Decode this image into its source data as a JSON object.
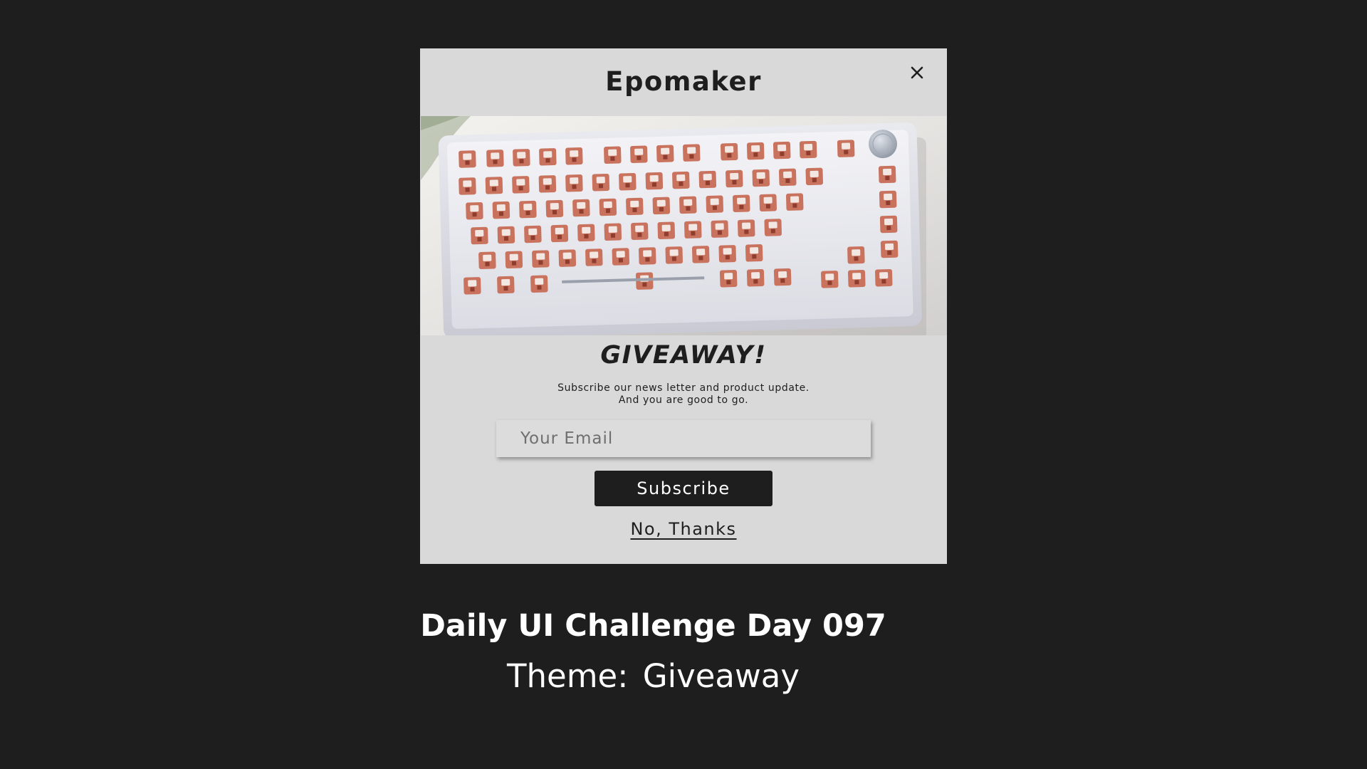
{
  "modal": {
    "brand": "Epomaker",
    "close_icon": "close-icon",
    "hero_image": "mechanical-keyboard-photo",
    "title": "GIVEAWAY!",
    "subtitle_line1": "Subscribe our news letter and product update.",
    "subtitle_line2": "And you are good to go.",
    "email_placeholder": "Your Email",
    "email_value": "",
    "subscribe_label": "Subscribe",
    "dismiss_label": "No, Thanks"
  },
  "caption": {
    "title": "Daily UI Challenge Day 097",
    "theme": "Theme:  Giveaway"
  },
  "colors": {
    "background": "#1e1e1e",
    "modal_background": "#d9d9d9",
    "button_background": "#1e1e1e",
    "button_text": "#ffffff",
    "caption_text": "#ffffff",
    "keycap_switch": "#c9735e"
  }
}
